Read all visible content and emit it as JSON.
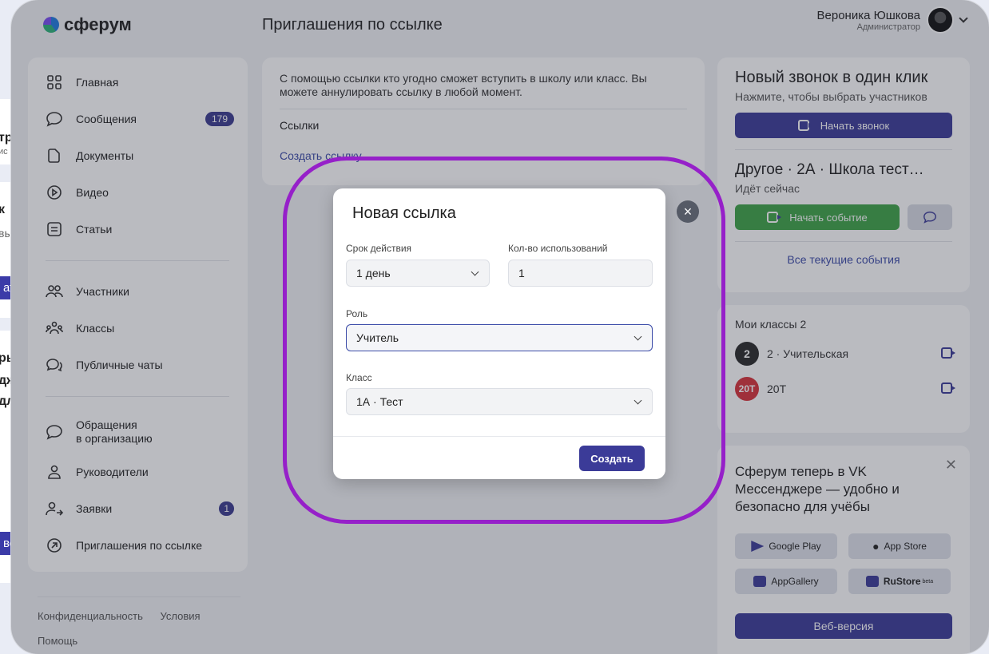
{
  "peek": {
    "t1": "тр",
    "s1": "ис",
    "t2": "к",
    "s2": "вы",
    "btn1": "ат",
    "t3": "ры",
    "t4": "дж",
    "t5": "дл",
    "btn2": "ве"
  },
  "header": {
    "logo": "сферум",
    "page_title": "Приглашения по ссылке",
    "user_name": "Вероника Юшкова",
    "user_role": "Администратор"
  },
  "sidebar": {
    "items": [
      {
        "label": "Главная",
        "icon": "grid-icon"
      },
      {
        "label": "Сообщения",
        "icon": "chat-icon",
        "badge": "179"
      },
      {
        "label": "Документы",
        "icon": "document-icon"
      },
      {
        "label": "Видео",
        "icon": "play-icon"
      },
      {
        "label": "Статьи",
        "icon": "article-icon"
      },
      {
        "label": "Участники",
        "icon": "people-icon"
      },
      {
        "label": "Классы",
        "icon": "classes-icon"
      },
      {
        "label": "Публичные чаты",
        "icon": "public-chat-icon"
      },
      {
        "label_line1": "Обращения",
        "label_line2": "в организацию",
        "icon": "chat-icon"
      },
      {
        "label": "Руководители",
        "icon": "person-icon"
      },
      {
        "label": "Заявки",
        "icon": "person-arrow-icon",
        "badge": "1"
      },
      {
        "label": "Приглашения по ссылке",
        "icon": "arrow-circle-icon"
      }
    ]
  },
  "footer": {
    "privacy": "Конфиденциальность",
    "terms": "Условия",
    "help": "Помощь"
  },
  "center": {
    "description": "С помощью ссылки кто угодно сможет вступить в школу или класс. Вы можете аннулировать ссылку в любой момент.",
    "links_label": "Ссылки",
    "create_link": "Создать ссылку"
  },
  "right": {
    "call_title": "Новый звонок в один клик",
    "call_sub": "Нажмите, чтобы выбрать участников",
    "call_button": "Начать звонок",
    "event_title": "Другое · 2А · Школа тест…",
    "event_status": "Идёт сейчас",
    "event_button": "Начать событие",
    "all_events": "Все текущие события",
    "my_classes_label": "Мои классы",
    "my_classes_count": "2",
    "classes": [
      {
        "avatar": "2",
        "name": "2 · Учительская",
        "color": "#2a2a2a"
      },
      {
        "avatar": "20Т",
        "name": "20Т",
        "color": "#d8333a"
      }
    ],
    "promo_text": "Сферум теперь в VK Мессенджере — удобно и безопасно для учёбы",
    "stores": [
      "Google Play",
      "App Store",
      "AppGallery",
      "RuStore"
    ],
    "rustore_tag": "beta",
    "web_button": "Веб-версия"
  },
  "modal": {
    "title": "Новая ссылка",
    "validity_label": "Срок действия",
    "validity_value": "1 день",
    "uses_label": "Кол-во использований",
    "uses_value": "1",
    "role_label": "Роль",
    "role_value": "Учитель",
    "class_label": "Класс",
    "class_value": "1А · Тест",
    "submit": "Создать",
    "close": "×"
  },
  "colors": {
    "accent": "#3b3b98",
    "green": "#3fa447",
    "highlight_ring": "#9620c9"
  }
}
